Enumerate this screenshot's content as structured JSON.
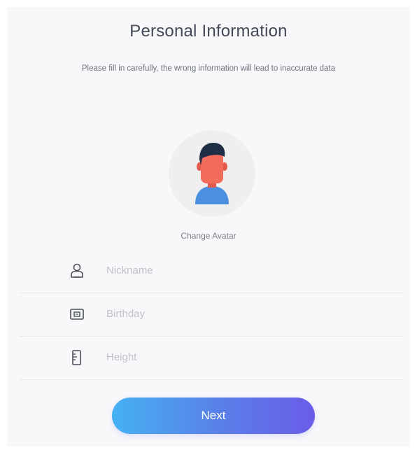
{
  "header": {
    "title": "Personal Information",
    "subtitle": "Please fill in carefully, the wrong information will lead to inaccurate data"
  },
  "avatar": {
    "icon": "male-avatar-icon",
    "change_label": "Change Avatar"
  },
  "form": {
    "fields": [
      {
        "icon": "user-icon",
        "placeholder": "Nickname",
        "value": ""
      },
      {
        "icon": "calendar-icon",
        "placeholder": "Birthday",
        "value": ""
      },
      {
        "icon": "height-icon",
        "placeholder": "Height",
        "value": ""
      }
    ]
  },
  "actions": {
    "next_label": "Next"
  },
  "colors": {
    "background": "#f8f8fb",
    "title": "#444a57",
    "button_gradient_start": "#45b1f2",
    "button_gradient_end": "#6b5ce8",
    "avatar_face": "#f26b5b",
    "avatar_shirt": "#4a8fe0",
    "avatar_hair": "#1f2e45"
  }
}
